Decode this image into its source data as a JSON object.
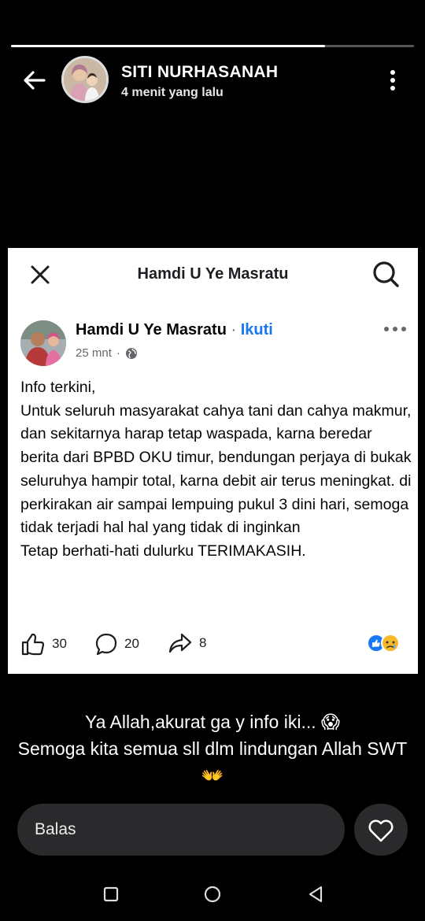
{
  "story": {
    "progress_fraction": 0.78,
    "author_name": "SITI NURHASANAH",
    "time_ago": "4 menit yang lalu",
    "back_icon": "arrow-left-icon",
    "menu_icon": "more-vertical-icon"
  },
  "shared_post": {
    "header_title": "Hamdi U Ye Masratu",
    "close_icon": "close-icon",
    "search_icon": "search-icon",
    "author": "Hamdi U Ye Masratu",
    "separator": " · ",
    "follow_label": "Ikuti",
    "time": "25 mnt",
    "privacy_icon": "globe-icon",
    "more_icon": "more-horizontal-icon",
    "body": "Info terkini,\nUntuk seluruh masyarakat cahya tani dan cahya makmur, dan sekitarnya harap tetap waspada, karna beredar berita dari BPBD OKU timur, bendungan perjaya di bukak seluruhya hampir total, karna debit air terus meningkat. di perkirakan air sampai lempuing pukul 3 dini hari, semoga tidak terjadi hal hal yang tidak di inginkan\nTetap berhati-hati dulurku TERIMAKASIH.",
    "likes": "30",
    "comments": "20",
    "shares": "8",
    "reaction_icons": [
      "like-reaction-icon",
      "sad-reaction-icon"
    ]
  },
  "reply": {
    "text": "Ya Allah,akurat ga y info iki... 😱\nSemoga kita semua sll dlm lindungan Allah SWT👐"
  },
  "reply_bar": {
    "placeholder": "Balas",
    "heart_icon": "heart-icon"
  },
  "nav": [
    "recent-apps-icon",
    "home-icon",
    "back-triangle-icon"
  ],
  "colors": {
    "background": "#000000",
    "card": "#ffffff",
    "follow_link": "#1877f2",
    "reply_bar": "#2a2a2c"
  }
}
